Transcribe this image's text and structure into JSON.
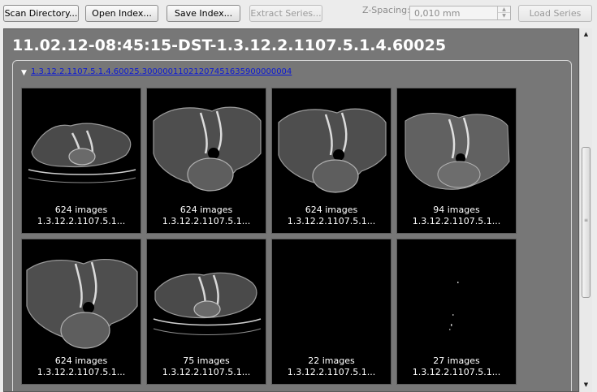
{
  "toolbar": {
    "scan_label": "Scan Directory...",
    "open_label": "Open Index...",
    "save_label": "Save Index...",
    "extract_label": "Extract Series...",
    "zspacing_label": "Z-Spacing:",
    "zspacing_value": "0,010 mm",
    "load_label": "Load Series"
  },
  "panel": {
    "title": "11.02.12-08:45:15-DST-1.3.12.2.1107.5.1.4.60025",
    "series_uid": "1.3.12.2.1107.5.1.4.60025.30000011021207451635900000004",
    "expand_icon": "triangle-down-icon"
  },
  "thumbnails": [
    {
      "count": "624 images",
      "uid": "1.3.12.2.1107.5.1..."
    },
    {
      "count": "624 images",
      "uid": "1.3.12.2.1107.5.1..."
    },
    {
      "count": "624 images",
      "uid": "1.3.12.2.1107.5.1..."
    },
    {
      "count": "94 images",
      "uid": "1.3.12.2.1107.5.1..."
    },
    {
      "count": "624 images",
      "uid": "1.3.12.2.1107.5.1..."
    },
    {
      "count": "75 images",
      "uid": "1.3.12.2.1107.5.1..."
    },
    {
      "count": "22 images",
      "uid": "1.3.12.2.1107.5.1..."
    },
    {
      "count": "27 images",
      "uid": "1.3.12.2.1107.5.1..."
    }
  ],
  "colors": {
    "panel_bg": "#777777",
    "link": "#0a18d6",
    "thumb_bg": "#000000"
  }
}
